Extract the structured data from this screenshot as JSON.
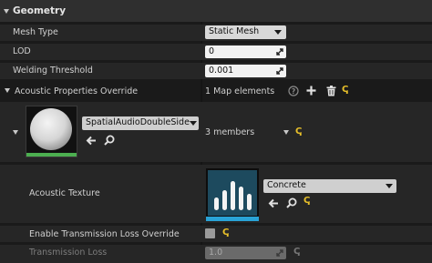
{
  "section": {
    "title": "Geometry"
  },
  "mesh_type": {
    "label": "Mesh Type",
    "value": "Static Mesh"
  },
  "lod": {
    "label": "LOD",
    "value": "0"
  },
  "welding": {
    "label": "Welding Threshold",
    "value": "0.001"
  },
  "acoustic_override": {
    "label": "Acoustic Properties Override",
    "summary": "1 Map elements"
  },
  "map_entry": {
    "key_asset": "SpatialAudioDoubleSidedM",
    "members": "3 members"
  },
  "acoustic_texture": {
    "label": "Acoustic Texture",
    "value": "Concrete"
  },
  "transmission_override": {
    "label": "Enable Transmission Loss Override"
  },
  "transmission_loss": {
    "label": "Transmission Loss",
    "value": "1.0"
  },
  "icons": {
    "reset": "ↅ"
  },
  "colors": {
    "accent": "#29a3d6",
    "reset": "#e8c02a"
  }
}
